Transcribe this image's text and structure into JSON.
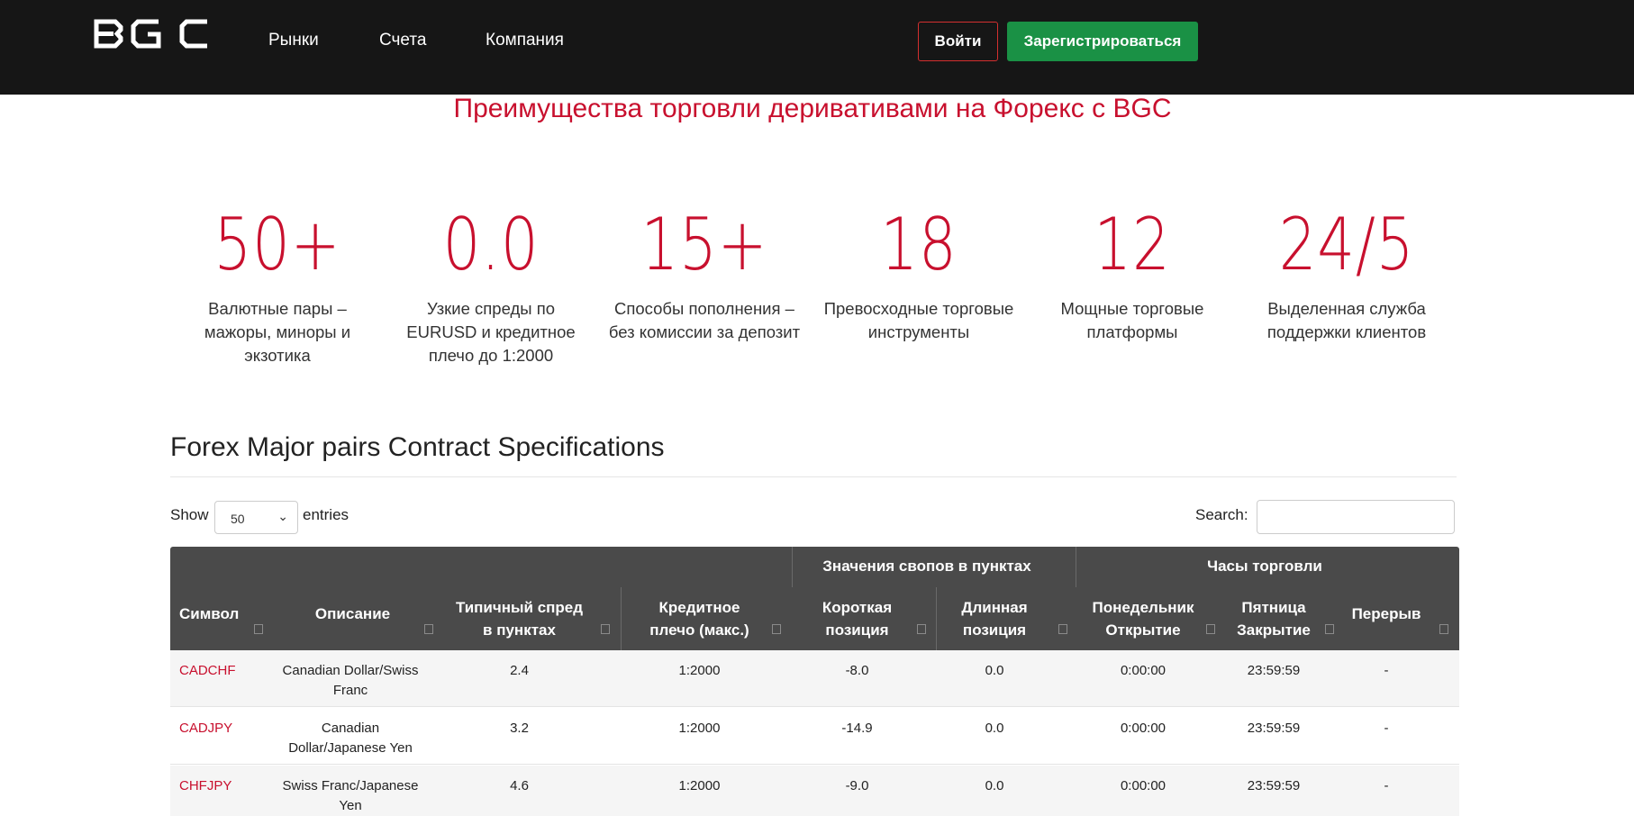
{
  "header": {
    "logo_text": "BGC",
    "nav": [
      "Рынки",
      "Счета",
      "Компания"
    ],
    "login_label": "Войти",
    "register_label": "Зарегистрироваться"
  },
  "hero": {
    "title": "Преимущества торговли деривативами на Форекс с BGC",
    "stats": [
      {
        "value": "50+",
        "desc": "Валютные пары – мажоры, миноры и экзотика"
      },
      {
        "value": "0.0",
        "desc": "Узкие спреды по EURUSD и кредитное плечо до 1:2000"
      },
      {
        "value": "15+",
        "desc": "Способы пополнения – без комиссии за депозит"
      },
      {
        "value": "18",
        "desc": "Превосходные торговые инструменты"
      },
      {
        "value": "12",
        "desc": "Мощные торговые платформы"
      },
      {
        "value": "24/5",
        "desc": "Выделенная служба поддержки клиентов"
      }
    ]
  },
  "specs": {
    "title": "Forex Major pairs Contract Specifications",
    "show_label": "Show",
    "entries_value": "50",
    "entries_label": "entries",
    "search_label": "Search:",
    "search_value": "",
    "group_headers": [
      "Значения свопов в пунктах",
      "Часы торговли"
    ],
    "columns": [
      {
        "l1": "",
        "l2": "Символ"
      },
      {
        "l1": "",
        "l2": "Описание"
      },
      {
        "l1": "Типичный спред",
        "l2": "в пунктах"
      },
      {
        "l1": "Кредитное",
        "l2": "плечо (макс.)"
      },
      {
        "l1": "Короткая",
        "l2": "позиция"
      },
      {
        "l1": "Длинная",
        "l2": "позиция"
      },
      {
        "l1": "Понедельник",
        "l2": "Открытие"
      },
      {
        "l1": "Пятница",
        "l2": "Закрытие"
      },
      {
        "l1": "",
        "l2": "Перерыв"
      }
    ],
    "rows": [
      {
        "symbol": "CADCHF",
        "desc1": "Canadian Dollar/Swiss",
        "desc2": "Franc",
        "spread": "2.4",
        "leverage": "1:2000",
        "short": "-8.0",
        "long": "0.0",
        "open": "0:00:00",
        "close": "23:59:59",
        "break": "-"
      },
      {
        "symbol": "CADJPY",
        "desc1": "Canadian",
        "desc2": "Dollar/Japanese Yen",
        "spread": "3.2",
        "leverage": "1:2000",
        "short": "-14.9",
        "long": "0.0",
        "open": "0:00:00",
        "close": "23:59:59",
        "break": "-"
      },
      {
        "symbol": "CHFJPY",
        "desc1": "Swiss Franc/Japanese",
        "desc2": "Yen",
        "spread": "4.6",
        "leverage": "1:2000",
        "short": "-9.0",
        "long": "0.0",
        "open": "0:00:00",
        "close": "23:59:59",
        "break": "-"
      }
    ]
  }
}
